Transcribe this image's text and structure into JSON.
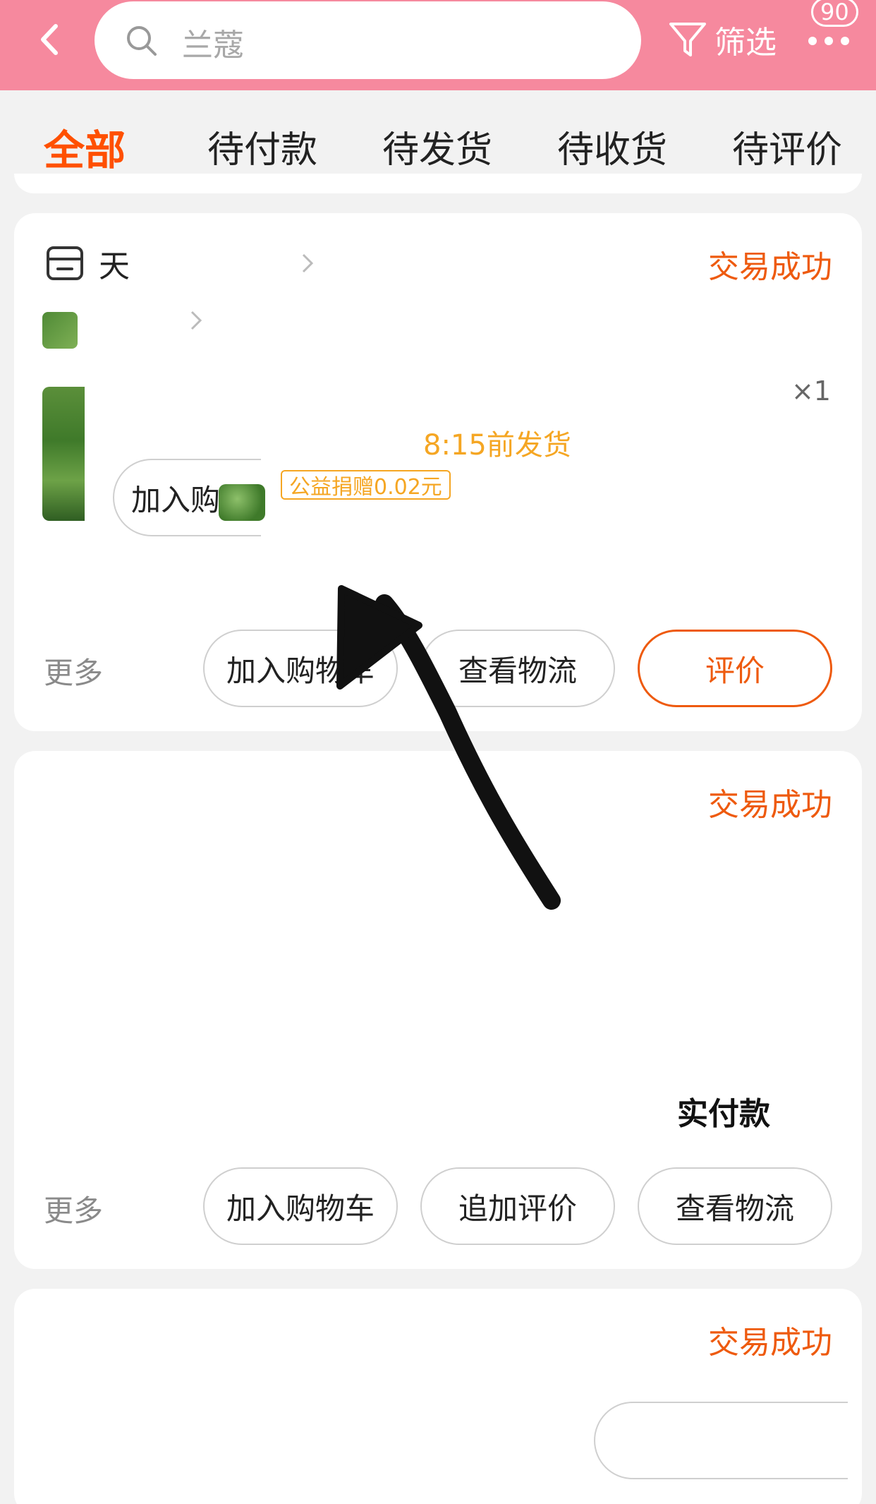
{
  "header": {
    "search_placeholder": "兰蔻",
    "filter_label": "筛选",
    "badge_count": "90",
    "background_color": "#f6899e"
  },
  "tabs": [
    {
      "label": "全部",
      "active": true
    },
    {
      "label": "待付款",
      "active": false
    },
    {
      "label": "待发货",
      "active": false
    },
    {
      "label": "待收货",
      "active": false
    },
    {
      "label": "待评价",
      "active": false
    }
  ],
  "orders": [
    {
      "shop_name": "天",
      "status": "交易成功",
      "quantity": "×1",
      "ship_info": "前发货",
      "ship_time": "8:15",
      "charity_tag": "公益捐赠0.02元",
      "overlay_button": "加入购",
      "more_label": "更多",
      "actions": [
        "加入购物车",
        "查看物流",
        "评价"
      ],
      "accent_color": "#ee5a0e"
    },
    {
      "status": "交易成功",
      "paid_label": "实付款",
      "more_label": "更多",
      "actions": [
        "加入购物车",
        "追加评价",
        "查看物流"
      ]
    },
    {
      "status": "交易成功"
    }
  ],
  "icons": {
    "back": "chevron-left-icon",
    "search": "search-icon",
    "filter": "filter-funnel-icon",
    "more": "more-dots-icon",
    "shop": "shop-icon",
    "arrow": "hand-drawn-arrow"
  }
}
